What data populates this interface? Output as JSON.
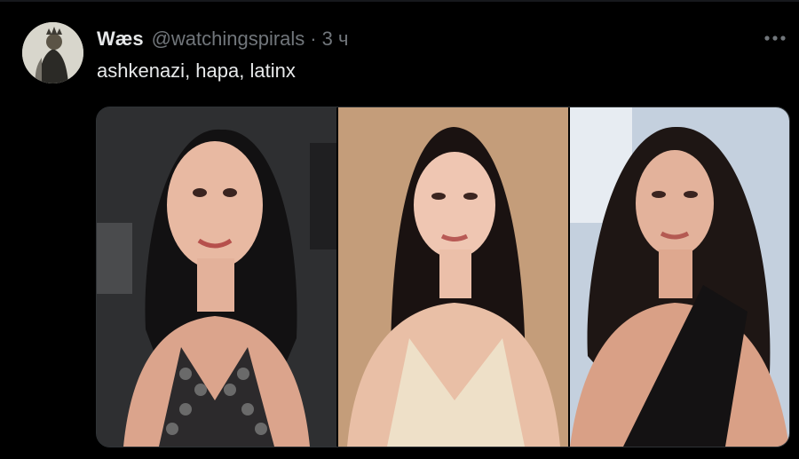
{
  "tweet": {
    "author_name": "Wæs",
    "author_handle": "@watchingspirals",
    "separator": "·",
    "time_ago": "3 ч",
    "text": "ashkenazi, hapa, latinx"
  },
  "media": {
    "photos": [
      {
        "label": "Photo 1"
      },
      {
        "label": "Photo 2"
      },
      {
        "label": "Photo 3"
      }
    ]
  },
  "icons": {
    "more": "more-icon",
    "avatar": "avatar"
  },
  "colors": {
    "background": "#000000",
    "text_primary": "#e7e9ea",
    "text_secondary": "#71767b",
    "border": "#2f3336"
  }
}
